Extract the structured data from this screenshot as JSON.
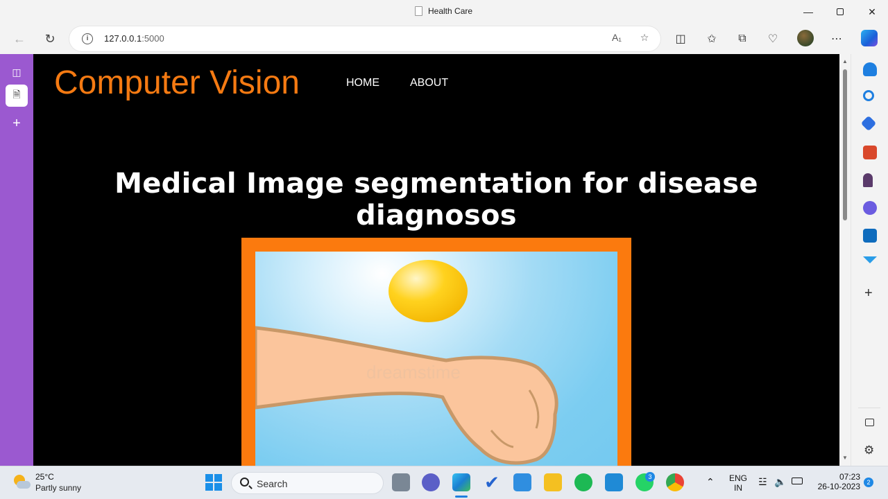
{
  "browser": {
    "tab_title": "Health Care",
    "url_host": "127.0.0.1",
    "url_port": ":5000"
  },
  "page": {
    "brand": "Computer Vision",
    "nav": [
      "HOME",
      "ABOUT"
    ],
    "headline": "Medical Image segmentation for disease diagnosos",
    "image_watermark": "dreamstime"
  },
  "taskbar": {
    "weather_temp": "25°C",
    "weather_desc": "Partly sunny",
    "search_label": "Search",
    "whatsapp_badge": "3",
    "lang_top": "ENG",
    "lang_bottom": "IN",
    "time": "07:23",
    "date": "26-10-2023",
    "notif_count": "2"
  },
  "colors": {
    "brand": "#f57a12",
    "frame": "#fb7a0e",
    "vertical_tabs": "#9b59d0"
  }
}
